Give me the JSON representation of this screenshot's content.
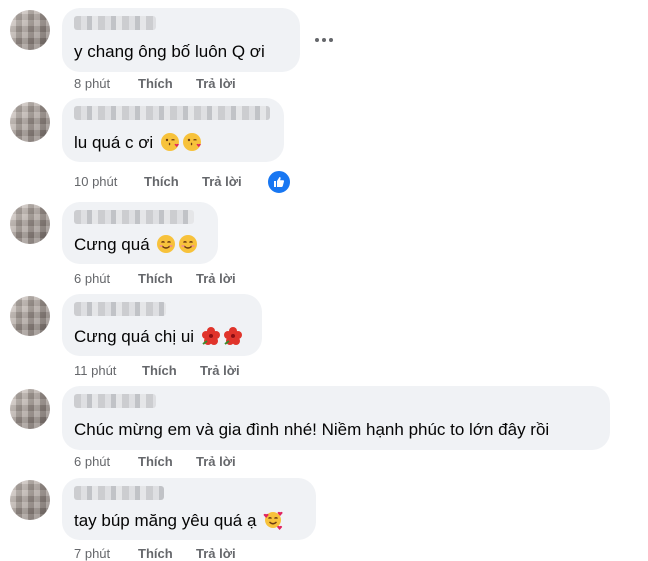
{
  "labels": {
    "like": "Thích",
    "reply": "Trả lời"
  },
  "comments": [
    {
      "text": "y chang ông bố luôn Q ơi",
      "time": "8 phút",
      "emojis": []
    },
    {
      "text": "lu quá c ơi",
      "time": "10 phút",
      "emojis": [
        "face-blowing-kiss",
        "face-blowing-kiss"
      ],
      "like_reaction_icon": "like-reaction-icon"
    },
    {
      "text": "Cưng quá",
      "time": "6 phút",
      "emojis": [
        "smiling-face",
        "smiling-face"
      ]
    },
    {
      "text": "Cưng quá chị ui",
      "time": "11 phút",
      "emojis": [
        "hibiscus",
        "hibiscus"
      ]
    },
    {
      "text": "Chúc mừng em và gia đình nhé! Niềm hạnh phúc to lớn đây rồi",
      "time": "6 phút",
      "emojis": []
    },
    {
      "text": "tay búp măng yêu quá ạ",
      "time": "7 phút",
      "emojis": [
        "smiling-face-with-hearts"
      ]
    }
  ],
  "colors": {
    "bubble": "#f0f2f5",
    "meta_text": "#65676b",
    "like_blue": "#1877f2"
  }
}
